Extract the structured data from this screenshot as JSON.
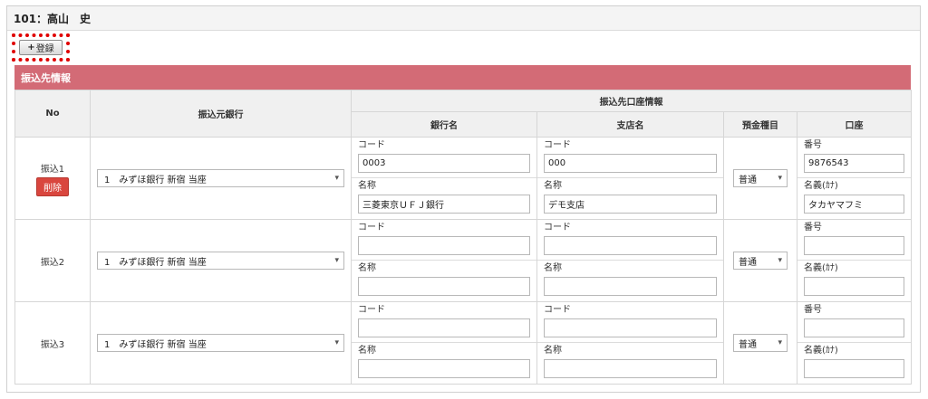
{
  "header": {
    "title": "101：高山　史"
  },
  "toolbar": {
    "register_icon": "+",
    "register_label": "登録"
  },
  "section": {
    "title": "振込先情報"
  },
  "table": {
    "headers": {
      "no": "No",
      "source_bank": "振込元銀行",
      "dest_account_info": "振込先口座情報",
      "bank_name": "銀行名",
      "branch_name": "支店名",
      "deposit_type": "預金種目",
      "account": "口座"
    },
    "labels": {
      "code": "コード",
      "name": "名称",
      "number": "番号",
      "holder_kana": "名義(ｶﾅ)"
    },
    "delete_label": "削除",
    "rows": [
      {
        "label": "振込1",
        "source_bank": "1　みずほ銀行 新宿 当座",
        "bank_code": "0003",
        "bank_name": "三菱東京ＵＦＪ銀行",
        "branch_code": "000",
        "branch_name": "デモ支店",
        "deposit_type": "普通",
        "account_number": "9876543",
        "account_holder": "タカヤマフミ"
      },
      {
        "label": "振込2",
        "source_bank": "1　みずほ銀行 新宿 当座",
        "bank_code": "",
        "bank_name": "",
        "branch_code": "",
        "branch_name": "",
        "deposit_type": "普通",
        "account_number": "",
        "account_holder": ""
      },
      {
        "label": "振込3",
        "source_bank": "1　みずほ銀行 新宿 当座",
        "bank_code": "",
        "bank_name": "",
        "branch_code": "",
        "branch_name": "",
        "deposit_type": "普通",
        "account_number": "",
        "account_holder": ""
      }
    ]
  }
}
